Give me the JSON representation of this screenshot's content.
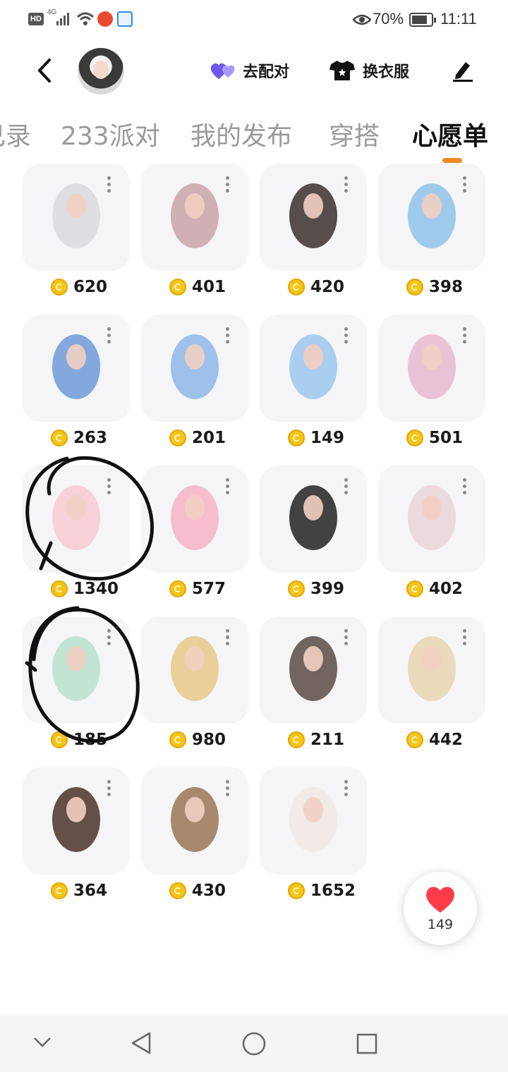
{
  "status_bar": {
    "network": "4G",
    "battery_percent": "70%",
    "time": "11:11"
  },
  "header": {
    "match_label": "去配对",
    "dress_label": "换衣服"
  },
  "tabs": [
    {
      "label": "记录",
      "partial": "己录"
    },
    {
      "label": "233派对"
    },
    {
      "label": "我的发布"
    },
    {
      "label": "穿搭"
    },
    {
      "label": "心愿单",
      "active": true
    }
  ],
  "wishlist": {
    "items": [
      {
        "price": "620",
        "icon": "white-twin-tail-hair-icon"
      },
      {
        "price": "401",
        "icon": "beret-brown-hair-icon"
      },
      {
        "price": "420",
        "icon": "black-cat-ear-hair-icon"
      },
      {
        "price": "398",
        "icon": "blue-feather-dress-icon"
      },
      {
        "price": "263",
        "icon": "blue-heels-icon"
      },
      {
        "price": "201",
        "icon": "blue-glove-icon"
      },
      {
        "price": "149",
        "icon": "denim-shorts-icon"
      },
      {
        "price": "501",
        "icon": "pink-skirt-stockings-icon"
      },
      {
        "price": "1340",
        "icon": "pink-hoodie-icon"
      },
      {
        "price": "577",
        "icon": "pink-leg-warmers-icon"
      },
      {
        "price": "399",
        "icon": "zebra-boots-icon"
      },
      {
        "price": "402",
        "icon": "lace-platform-shoes-icon"
      },
      {
        "price": "185",
        "icon": "mint-lolita-dress-icon"
      },
      {
        "price": "980",
        "icon": "golden-gown-icon"
      },
      {
        "price": "211",
        "icon": "black-tights-icon"
      },
      {
        "price": "442",
        "icon": "blonde-hair-icon"
      },
      {
        "price": "364",
        "icon": "brown-bun-hair-icon"
      },
      {
        "price": "430",
        "icon": "brown-lace-skirt-icon"
      },
      {
        "price": "1652",
        "icon": "white-lace-dress-icon"
      }
    ]
  },
  "like_fab": {
    "count": "149"
  },
  "colors": {
    "accent": "#f08a24",
    "coin": "#f5c518",
    "heart": "#ff3b4a",
    "purple": "#7b5cf0",
    "card_bg": "#f5f5f7"
  }
}
